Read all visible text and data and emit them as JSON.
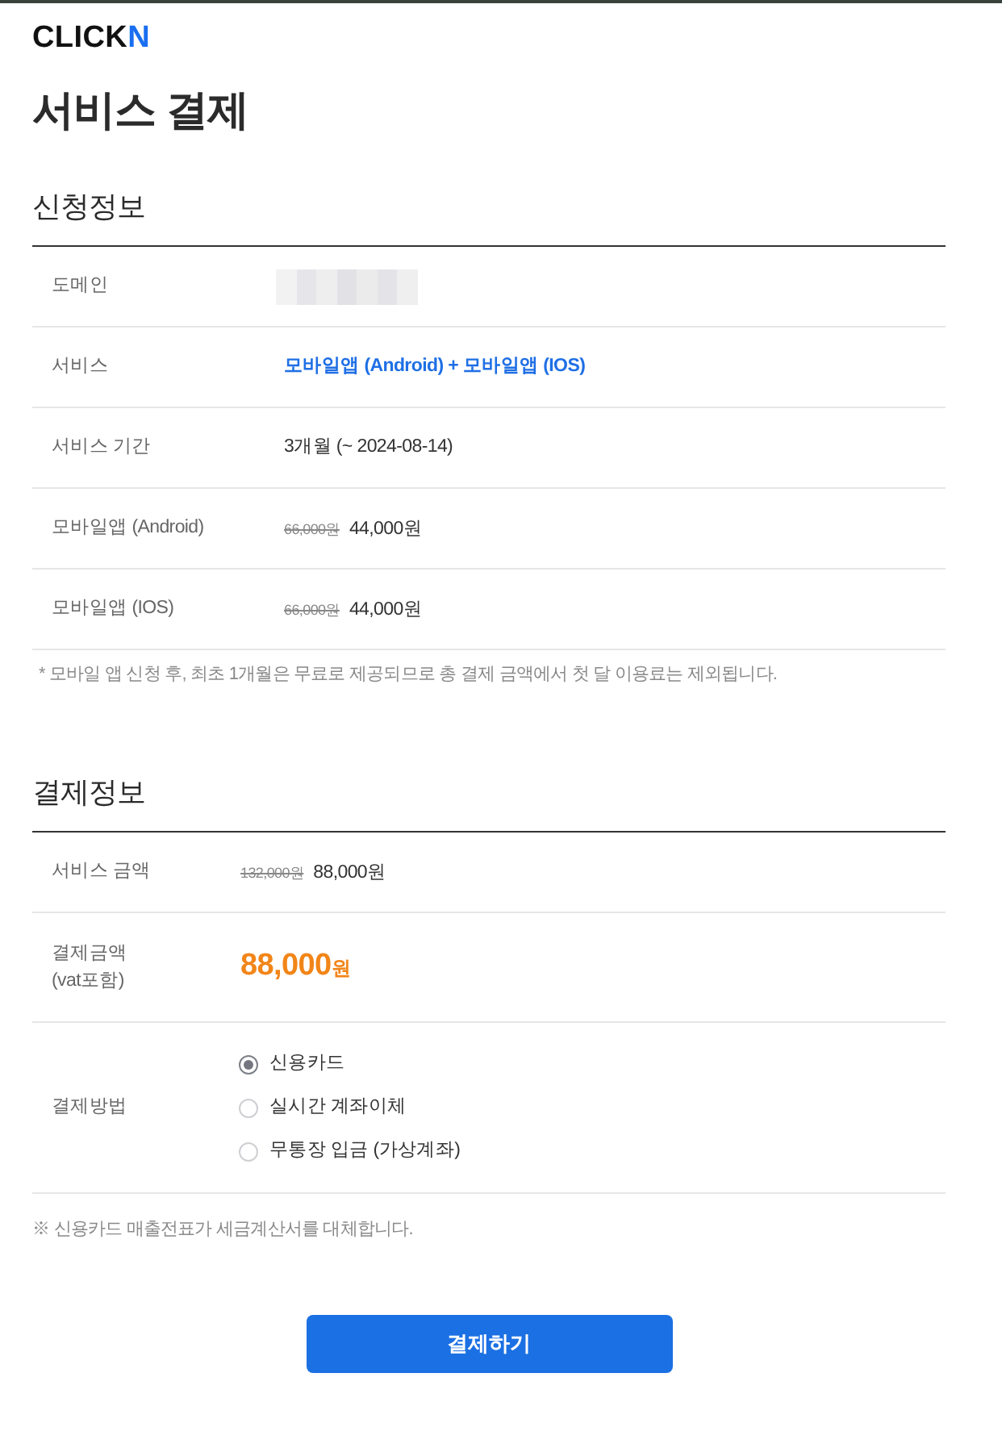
{
  "logo": {
    "text": "CLICK",
    "accent": "N"
  },
  "title": "서비스 결제",
  "sections": [
    {
      "heading": "신청정보",
      "rows": [
        {
          "kind": "redacted",
          "label": "도메인"
        },
        {
          "kind": "highlight",
          "label": "서비스",
          "value": "모바일앱 (Android) + 모바일앱 (IOS)"
        },
        {
          "kind": "text",
          "label": "서비스 기간",
          "value": "3개월 (~ 2024-08-14)"
        },
        {
          "kind": "price",
          "label": "모바일앱 (Android)",
          "original_price": "66,000원",
          "price": "44,000원"
        },
        {
          "kind": "price",
          "label": "모바일앱 (IOS)",
          "original_price": "66,000원",
          "price": "44,000원"
        }
      ],
      "note": "* 모바일 앱 신청 후, 최초 1개월은 무료로 제공되므로 총 결제 금액에서 첫 달 이용료는 제외됩니다."
    },
    {
      "heading": "결제정보",
      "rows": [
        {
          "kind": "price",
          "label": "서비스 금액",
          "original_price": "132,000원",
          "price": "88,000원"
        },
        {
          "kind": "total",
          "label": "결제금액\n(vat포함)",
          "amount": "88,000",
          "unit": "원"
        },
        {
          "kind": "radio",
          "label": "결제방법",
          "options": [
            {
              "label": "신용카드",
              "selected": true
            },
            {
              "label": "실시간 계좌이체",
              "selected": false
            },
            {
              "label": "무통장 입금 (가상계좌)",
              "selected": false
            }
          ]
        }
      ],
      "note": "※ 신용카드 매출전표가 세금계산서를 대체합니다."
    }
  ],
  "submit_button": "결제하기"
}
